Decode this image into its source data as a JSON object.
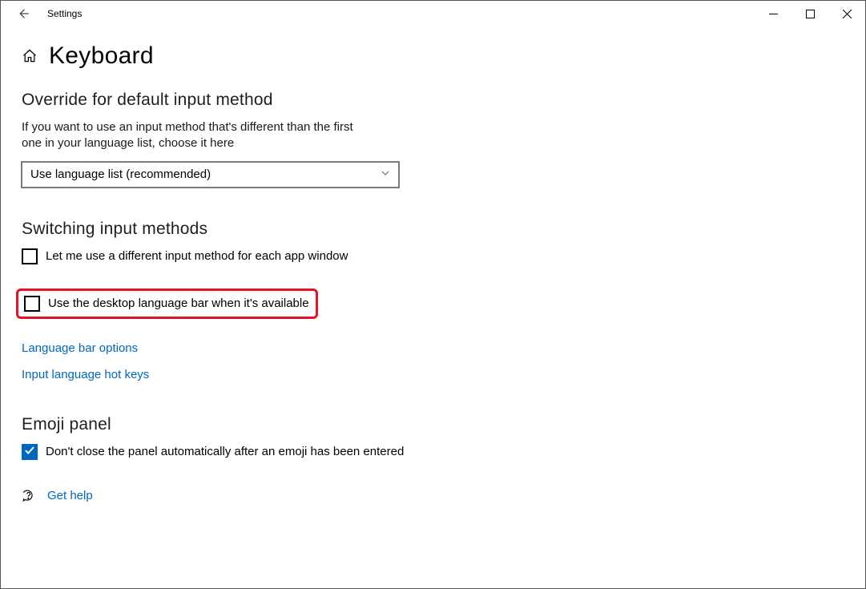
{
  "window": {
    "title": "Settings"
  },
  "page": {
    "title": "Keyboard"
  },
  "override": {
    "heading": "Override for default input method",
    "description": "If you want to use an input method that's different than the first one in your language list, choose it here",
    "selected": "Use language list (recommended)"
  },
  "switching": {
    "heading": "Switching input methods",
    "cb_per_app": "Let me use a different input method for each app window",
    "cb_desktop_bar": "Use the desktop language bar when it's available",
    "link_langbar": "Language bar options",
    "link_hotkeys": "Input language hot keys"
  },
  "emoji": {
    "heading": "Emoji panel",
    "cb_dont_close": "Don't close the panel automatically after an emoji has been entered"
  },
  "help": {
    "label": "Get help"
  }
}
